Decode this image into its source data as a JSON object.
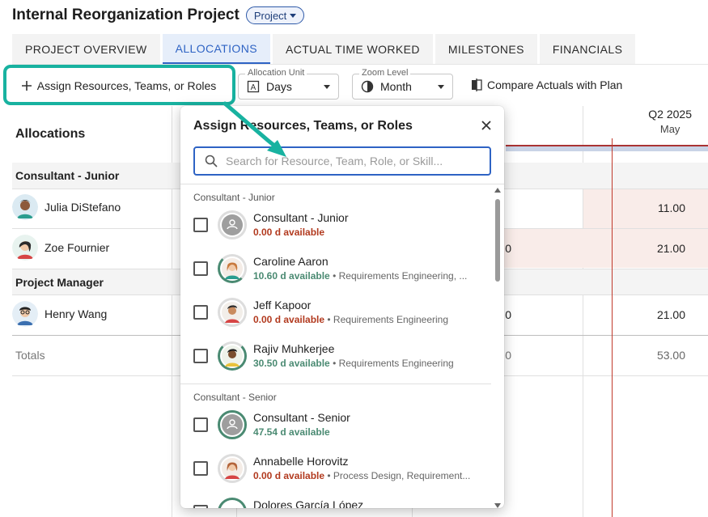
{
  "header": {
    "title": "Internal Reorganization Project",
    "badge": "Project"
  },
  "tabs": [
    {
      "label": "PROJECT OVERVIEW"
    },
    {
      "label": "ALLOCATIONS"
    },
    {
      "label": "ACTUAL TIME WORKED"
    },
    {
      "label": "MILESTONES"
    },
    {
      "label": "FINANCIALS"
    }
  ],
  "toolbar": {
    "assign_label": "Assign Resources, Teams, or Roles",
    "allocation_unit": {
      "label": "Allocation Unit",
      "value": "Days"
    },
    "zoom_level": {
      "label": "Zoom Level",
      "value": "Month"
    },
    "compare_label": "Compare Actuals with Plan"
  },
  "grid": {
    "heading": "Allocations",
    "period": {
      "quarter": "Q2 2025",
      "month": "May"
    },
    "groups": [
      {
        "label": "Consultant - Junior"
      },
      {
        "label": "Project Manager"
      }
    ],
    "people": [
      {
        "name": "Julia DiStefano",
        "mid": "",
        "value": "11.00"
      },
      {
        "name": "Zoe Fournier",
        "mid": "0",
        "value": "21.00"
      },
      {
        "name": "Henry Wang",
        "mid": "0",
        "value": "21.00"
      }
    ],
    "totals": {
      "label": "Totals",
      "mid": "0",
      "value": "53.00"
    }
  },
  "popup": {
    "title": "Assign Resources, Teams, or Roles",
    "search_placeholder": "Search for Resource, Team, Role, or Skill...",
    "sections": [
      {
        "label": "Consultant - Junior",
        "items": [
          {
            "name": "Consultant - Junior",
            "avail": "0.00 d available",
            "detail": ""
          },
          {
            "name": "Caroline Aaron",
            "avail": "10.60 d available",
            "detail": " • Requirements Engineering, ..."
          },
          {
            "name": "Jeff Kapoor",
            "avail": "0.00 d available",
            "detail": " • Requirements Engineering"
          },
          {
            "name": "Rajiv Muhkerjee",
            "avail": "30.50 d available",
            "detail": " • Requirements Engineering"
          }
        ]
      },
      {
        "label": "Consultant - Senior",
        "items": [
          {
            "name": "Consultant - Senior",
            "avail": "47.54 d available",
            "detail": ""
          },
          {
            "name": "Annabelle Horovitz",
            "avail": "0.00 d available",
            "detail": " • Process Design, Requirement..."
          },
          {
            "name": "Dolores García López",
            "avail": "",
            "detail": ""
          }
        ]
      }
    ]
  },
  "colors": {
    "accent": "#2e63c4",
    "highlight": "#18b2a0",
    "unavailable": "#b23a1f",
    "available": "#4a8a72"
  }
}
